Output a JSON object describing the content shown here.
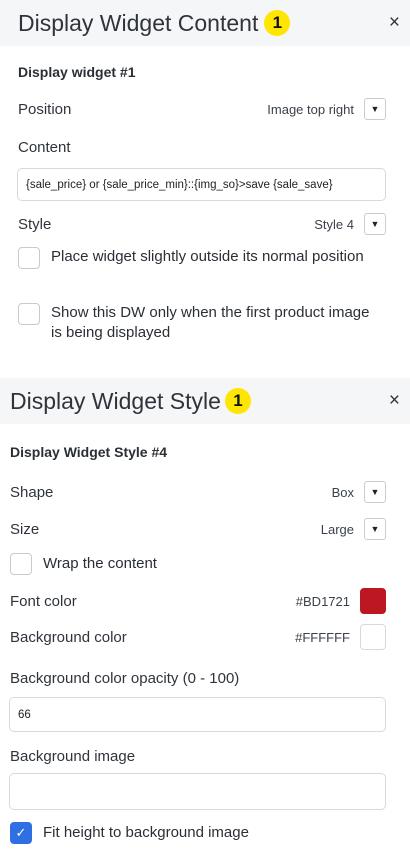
{
  "content_panel": {
    "title": "Display Widget Content",
    "badge": "1",
    "close_icon": "×",
    "section_title": "Display widget #1",
    "position_label": "Position",
    "position_value": "Image top right",
    "content_label": "Content",
    "content_value": "{sale_price} or {sale_price_min}::{img_so}>save {sale_save}",
    "style_label": "Style",
    "style_value": "Style 4",
    "check_outside": "Place widget slightly outside its normal position",
    "check_outside_checked": false,
    "check_first_image": "Show this DW only when the first product image is being displayed",
    "check_first_image_checked": false
  },
  "style_panel": {
    "title": "Display Widget Style",
    "badge": "1",
    "close_icon": "×",
    "section_title": "Display Widget Style #4",
    "shape_label": "Shape",
    "shape_value": "Box",
    "size_label": "Size",
    "size_value": "Large",
    "wrap_label": "Wrap the content",
    "wrap_checked": false,
    "font_color_label": "Font color",
    "font_color_value": "#BD1721",
    "bg_color_label": "Background color",
    "bg_color_value": "#FFFFFF",
    "opacity_label": "Background color opacity (0 - 100)",
    "opacity_value": "66",
    "bg_image_label": "Background image",
    "bg_image_value": "",
    "fit_label": "Fit height to background image",
    "fit_checked": true
  },
  "icons": {
    "dropdown": "▼",
    "check": "✓"
  }
}
